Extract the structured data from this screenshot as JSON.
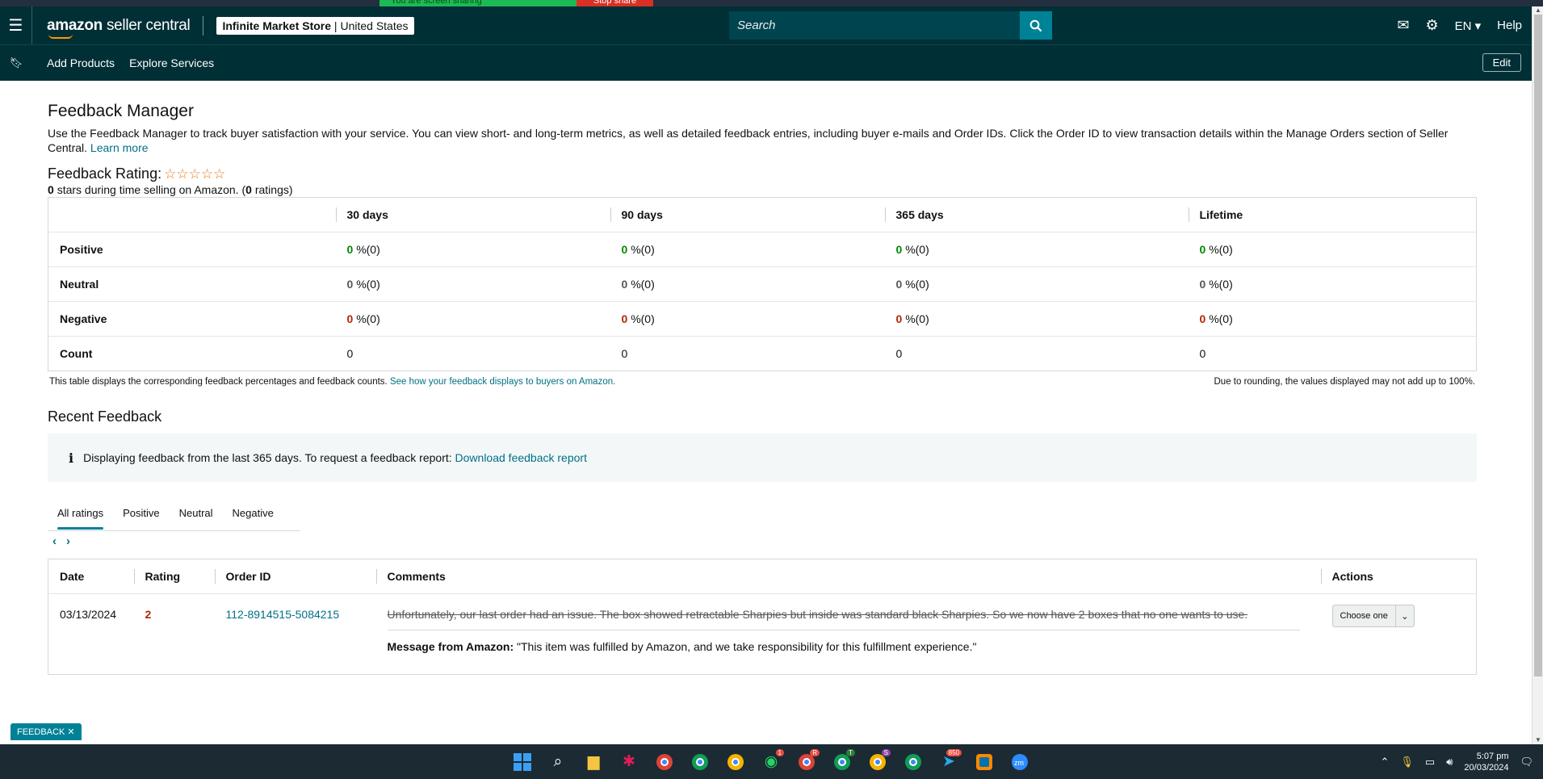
{
  "screen_share": {
    "message": "You are screen sharing",
    "stop_label": "Stop share"
  },
  "header": {
    "logo_brand": "amazon",
    "logo_suffix": "seller central",
    "store_name": "Infinite Market Store",
    "store_region": "United States",
    "search_placeholder": "Search",
    "language": "EN",
    "help": "Help"
  },
  "subnav": {
    "items": [
      "Add Products",
      "Explore Services"
    ],
    "edit": "Edit"
  },
  "page": {
    "title": "Feedback Manager",
    "description": "Use the Feedback Manager to track buyer satisfaction with your service. You can view short- and long-term metrics, as well as detailed feedback entries, including buyer e-mails and Order IDs. Click the Order ID to view transaction details within the Manage Orders section of Seller Central.",
    "learn_more": "Learn more",
    "rating_label": "Feedback Rating:",
    "stars": "☆☆☆☆☆",
    "stars_count": "0",
    "stars_text": "stars during time selling on Amazon. (",
    "ratings_count": "0",
    "ratings_text": "ratings)"
  },
  "metrics": {
    "columns": [
      "30 days",
      "90 days",
      "365 days",
      "Lifetime"
    ],
    "rows": [
      {
        "label": "Positive",
        "values": [
          "0",
          "0",
          "0",
          "0"
        ],
        "suffix": "%(0)"
      },
      {
        "label": "Neutral",
        "values": [
          "0",
          "0",
          "0",
          "0"
        ],
        "suffix": "%(0)"
      },
      {
        "label": "Negative",
        "values": [
          "0",
          "0",
          "0",
          "0"
        ],
        "suffix": "%(0)"
      },
      {
        "label": "Count",
        "values": [
          "0",
          "0",
          "0",
          "0"
        ]
      }
    ],
    "footnote_left": "This table displays the corresponding feedback percentages and feedback counts.",
    "footnote_link": "See how your feedback displays to buyers on Amazon.",
    "footnote_right": "Due to rounding, the values displayed may not add up to 100%."
  },
  "recent": {
    "title": "Recent Feedback",
    "info_text": "Displaying feedback from the last 365 days. To request a feedback report:",
    "info_link": "Download feedback report",
    "tabs": [
      "All ratings",
      "Positive",
      "Neutral",
      "Negative"
    ],
    "active_tab": "All ratings",
    "columns": [
      "Date",
      "Rating",
      "Order ID",
      "Comments",
      "Actions"
    ],
    "rows": [
      {
        "date": "03/13/2024",
        "rating": "2",
        "order_id": "112-8914515-5084215",
        "comment": "Unfortunately, our last order had an issue. The box showed retractable Sharpies but inside was standard black Sharpies. So we now have 2 boxes that no one wants to use.",
        "amazon_label": "Message from Amazon:",
        "amazon_message": "\"This item was fulfilled by Amazon, and we take responsibility for this fulfillment experience.\"",
        "action": "Choose one"
      }
    ]
  },
  "feedback_tab": "FEEDBACK",
  "taskbar": {
    "badges": {
      "whatsapp": "1",
      "chrome_r": "R",
      "chrome_t": "T",
      "chrome_s": "S",
      "telegram": "850"
    },
    "time": "5:07 pm",
    "date": "20/03/2024"
  },
  "colors": {
    "header": "#002f36",
    "accent": "#008296",
    "link": "#007185",
    "positive": "#008a00",
    "negative": "#b12704"
  }
}
